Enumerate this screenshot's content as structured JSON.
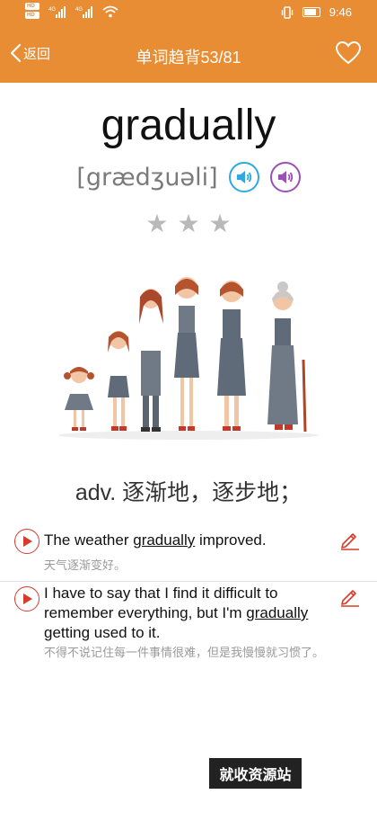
{
  "status_bar": {
    "time": "9:46",
    "sim1": "HD",
    "sim2": "HD",
    "net1": "4G",
    "net2": "4G"
  },
  "nav": {
    "back_label": "返回",
    "title": "单词趋背53/81"
  },
  "word": {
    "text": "gradually",
    "phonetic": "[grædʒuəli]",
    "stars": 3
  },
  "meaning": "adv. 逐渐地，逐步地；",
  "sentences": [
    {
      "en_before": "The weather ",
      "keyword": "gradually",
      "en_after": " improved.",
      "zh": "天气逐渐变好。"
    },
    {
      "en_before": "I have to say that I find it difficult to remember everything, but I'm ",
      "keyword": "gradually",
      "en_after": " getting used to it.",
      "zh": "不得不说记住每一件事情很难，但是我慢慢就习惯了。"
    }
  ],
  "watermark": "就收资源站",
  "colors": {
    "accent": "#e98d34",
    "play_red": "#d63b2b",
    "speaker_blue": "#2fa7e0",
    "speaker_purple": "#9b4fb8",
    "star_gray": "#b9b9b9"
  }
}
